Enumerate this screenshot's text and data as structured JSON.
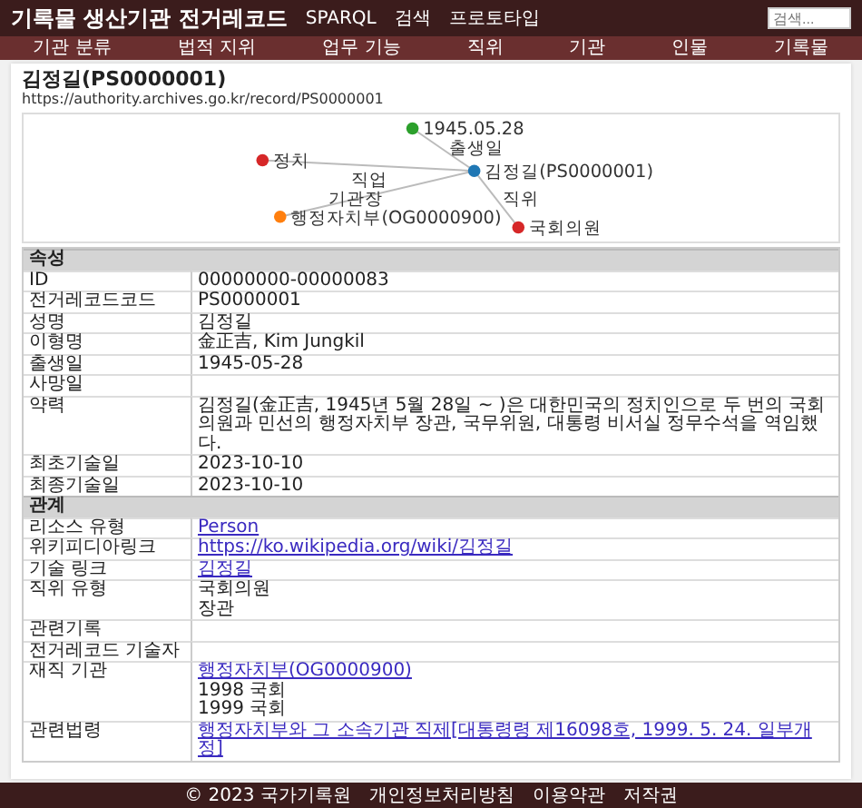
{
  "header": {
    "title": "기록물 생산기관 전거레코드",
    "links": [
      "SPARQL",
      "검색",
      "프로토타입"
    ],
    "search": {
      "placeholder": "검색..."
    }
  },
  "nav": [
    "기관 분류",
    "법적 지위",
    "업무 기능",
    "직위",
    "기관",
    "인물",
    "기록물"
  ],
  "record": {
    "title": "김정길(PS0000001)",
    "uri": "https://authority.archives.go.kr/record/PS0000001",
    "graph": {
      "nodes": [
        {
          "label": "1945.05.28",
          "color": "#2ca02c"
        },
        {
          "label": "정치",
          "color": "#d62728"
        },
        {
          "label": "김정길(PS0000001)",
          "color": "#1f77b4"
        },
        {
          "label": "행정자치부(OG0000900)",
          "color": "#ff7f0e"
        },
        {
          "label": "국회의원",
          "color": "#d62728"
        }
      ],
      "edges": [
        {
          "label": "출생일"
        },
        {
          "label": "직업"
        },
        {
          "label": "기관장"
        },
        {
          "label": "직위"
        }
      ]
    },
    "sections": [
      {
        "title": "속성",
        "rows": [
          {
            "label": "ID",
            "values": [
              {
                "kind": "text",
                "text": "00000000-00000083"
              }
            ]
          },
          {
            "label": "전거레코드코드",
            "values": [
              {
                "kind": "text",
                "text": "PS0000001"
              }
            ]
          },
          {
            "label": "성명",
            "values": [
              {
                "kind": "text",
                "text": "김정길"
              }
            ]
          },
          {
            "label": "이형명",
            "values": [
              {
                "kind": "text",
                "text": "金正吉, Kim Jungkil"
              }
            ]
          },
          {
            "label": "출생일",
            "values": [
              {
                "kind": "text",
                "text": "1945-05-28"
              }
            ]
          },
          {
            "label": "사망일"
          },
          {
            "label": "약력",
            "values": [
              {
                "kind": "text",
                "text": "김정길(金正吉, 1945년 5월 28일 ~ )은 대한민국의 정치인으로 두 번의 국회의원과 민선의 행정자치부 장관, 국무위원, 대통령 비서실 정무수석을 역임했다."
              }
            ]
          },
          {
            "label": "최초기술일",
            "values": [
              {
                "kind": "text",
                "text": "2023-10-10"
              }
            ]
          },
          {
            "label": "최종기술일",
            "values": [
              {
                "kind": "text",
                "text": "2023-10-10"
              }
            ]
          }
        ]
      },
      {
        "title": "관계",
        "rows": [
          {
            "label": "리소스 유형",
            "values": [
              {
                "kind": "link",
                "text": "Person"
              }
            ]
          },
          {
            "label": "위키피디아링크",
            "values": [
              {
                "kind": "link",
                "text": "https://ko.wikipedia.org/wiki/김정길"
              }
            ]
          },
          {
            "label": "기술 링크",
            "values": [
              {
                "kind": "link",
                "text": "김정길"
              }
            ]
          },
          {
            "label": "직위 유형",
            "values": [
              {
                "kind": "text",
                "text": "국회의원"
              },
              {
                "kind": "text",
                "text": "장관"
              }
            ]
          },
          {
            "label": "관련기록"
          },
          {
            "label": "전거레코드 기술자"
          },
          {
            "label": "재직 기관",
            "values": [
              {
                "kind": "link",
                "text": "행정자치부(OG0000900)"
              },
              {
                "kind": "text",
                "text": "1998 국회"
              },
              {
                "kind": "text",
                "text": "1999 국회"
              }
            ]
          },
          {
            "label": "관련법령",
            "values": [
              {
                "kind": "link",
                "text": "행정자치부와 그 소속기관 직제[대통령령 제16098호, 1999. 5. 24. 일부개정]"
              }
            ]
          }
        ]
      }
    ]
  },
  "footer": {
    "copyright": "© 2023 국가기록원",
    "links": [
      "개인정보처리방침",
      "이용약관",
      "저작권"
    ]
  }
}
